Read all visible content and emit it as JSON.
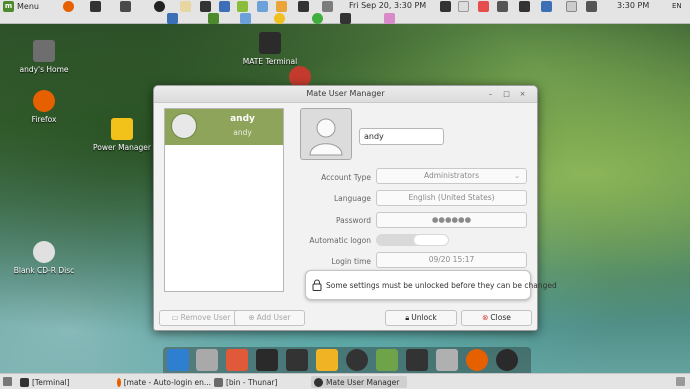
{
  "top_panel": {
    "menu_label": "Menu",
    "clock_center": "Fri Sep 20,  3:30 PM",
    "clock_right": "3:30 PM",
    "keyboard_layout": "EN"
  },
  "desktop": {
    "icons": [
      {
        "label": "andy's Home"
      },
      {
        "label": "Firefox"
      },
      {
        "label": "Power Manager"
      },
      {
        "label": "MATE Terminal"
      },
      {
        "label": "Blank CD-R Disc"
      }
    ]
  },
  "window": {
    "title": "Mate User Manager",
    "users": [
      {
        "name": "andy",
        "sub": "andy"
      }
    ],
    "name_value": "andy",
    "fields": {
      "account_type_label": "Account Type",
      "account_type_value": "Administrators",
      "language_label": "Language",
      "language_value": "English (United States)",
      "password_label": "Password",
      "password_value": "●●●●●●",
      "autologon_label": "Automatic logon",
      "login_time_label": "Login time",
      "login_time_value": "09/20 15:17"
    },
    "notice": "Some settings must be unlocked before they can be changed",
    "buttons": {
      "remove_user": "Remove User",
      "add_user": "Add User",
      "unlock": "Unlock",
      "close": "Close"
    }
  },
  "taskbar": {
    "items": [
      {
        "label": "[Terminal]"
      },
      {
        "label": "[mate - Auto-login en..."
      },
      {
        "label": "[bin - Thunar]"
      },
      {
        "label": "Mate User Manager"
      }
    ]
  },
  "colors": {
    "selected_row": "#8da45a",
    "panel_bg": "#e4e4e4",
    "close_icon": "#d33b3b"
  }
}
